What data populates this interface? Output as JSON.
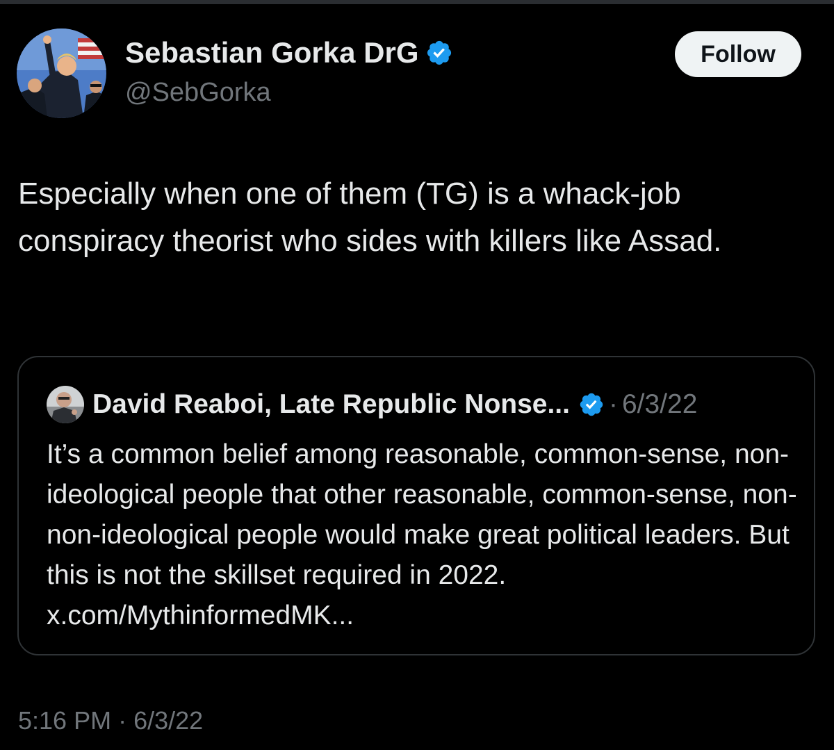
{
  "author": {
    "display_name": "Sebastian Gorka DrG",
    "handle": "@SebGorka",
    "verified_icon": "verified-badge-icon"
  },
  "follow_button": {
    "label": "Follow"
  },
  "tweet": {
    "text": "Especially when one of them (TG) is a whack-job conspiracy theorist who sides with killers like Assad."
  },
  "quoted_tweet": {
    "author_name": "David Reaboi, Late Republic Nonse...",
    "separator": "·",
    "date": "6/3/22",
    "text": "It’s a common belief among reasonable, common-sense, non-ideological people that other reasonable, common-sense, non- non-ideological people would make great political leaders. But this is not the skillset required in 2022. x.com/MythinformedMK..."
  },
  "meta": {
    "time": "5:16 PM",
    "separator": "·",
    "date": "6/3/22"
  },
  "colors": {
    "background": "#000000",
    "text_primary": "#e7e9ea",
    "text_secondary": "#71767b",
    "border": "#2f3336",
    "verified_blue": "#1d9bf0",
    "follow_bg": "#eff3f4"
  }
}
